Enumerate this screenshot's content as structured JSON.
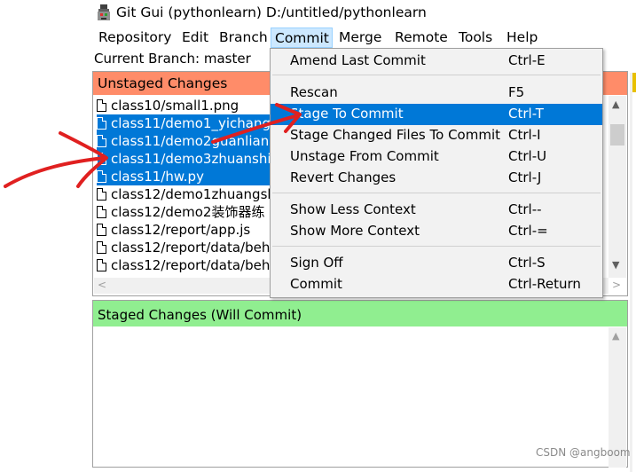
{
  "window": {
    "title": "Git Gui (pythonlearn) D:/untitled/pythonlearn",
    "icon": "git-gui-icon"
  },
  "menubar": [
    "Repository",
    "Edit",
    "Branch",
    "Commit",
    "Merge",
    "Remote",
    "Tools",
    "Help"
  ],
  "active_menu": "Commit",
  "branch_line": "Current Branch: master",
  "unstaged": {
    "title": "Unstaged Changes",
    "header_color": "#ff8c69",
    "files": [
      {
        "name": "class10/small1.png",
        "selected": false
      },
      {
        "name": "class11/demo1_yichang",
        "selected": true
      },
      {
        "name": "class11/demo2guanlian",
        "selected": true
      },
      {
        "name": "class11/demo3zhuanshi",
        "selected": true
      },
      {
        "name": "class11/hw.py",
        "selected": true
      },
      {
        "name": "class12/demo1zhuangsh",
        "selected": false
      },
      {
        "name": "class12/demo2装饰器练",
        "selected": false
      },
      {
        "name": "class12/report/app.js",
        "selected": false
      },
      {
        "name": "class12/report/data/beh",
        "selected": false
      },
      {
        "name": "class12/report/data/beh",
        "selected": false
      }
    ]
  },
  "staged": {
    "title": "Staged Changes (Will Commit)",
    "header_color": "#90ee90"
  },
  "commit_menu": {
    "items": [
      {
        "label": "Amend Last Commit",
        "accel": "Ctrl-E"
      },
      {
        "label": "Rescan",
        "accel": "F5"
      },
      {
        "label": "Stage To Commit",
        "accel": "Ctrl-T",
        "highlighted": true
      },
      {
        "label": "Stage Changed Files To Commit",
        "accel": "Ctrl-I"
      },
      {
        "label": "Unstage From Commit",
        "accel": "Ctrl-U"
      },
      {
        "label": "Revert Changes",
        "accel": "Ctrl-J"
      },
      {
        "label": "Show Less Context",
        "accel": "Ctrl--"
      },
      {
        "label": "Show More Context",
        "accel": "Ctrl-="
      },
      {
        "label": "Sign Off",
        "accel": "Ctrl-S"
      },
      {
        "label": "Commit",
        "accel": "Ctrl-Return"
      }
    ]
  },
  "highlight_color": "#0078d7",
  "annotation_color": "#e02020",
  "watermark": "CSDN @angboom"
}
